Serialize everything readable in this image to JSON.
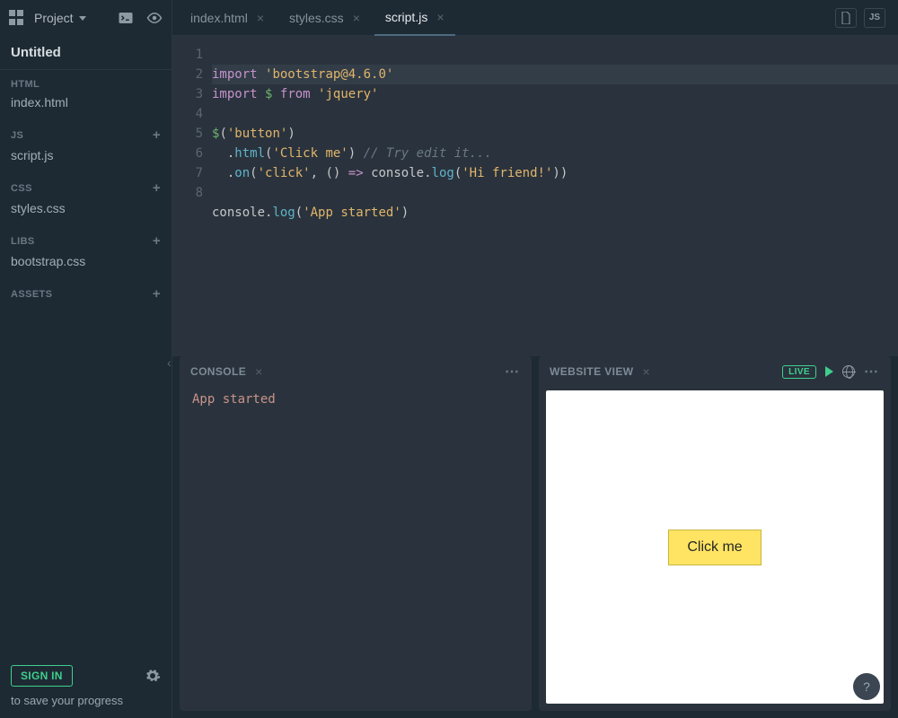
{
  "sidebar": {
    "project_label": "Project",
    "title": "Untitled",
    "sections": {
      "html": {
        "label": "HTML",
        "file": "index.html"
      },
      "js": {
        "label": "JS",
        "file": "script.js"
      },
      "css": {
        "label": "CSS",
        "file": "styles.css"
      },
      "libs": {
        "label": "LIBS",
        "file": "bootstrap.css"
      },
      "assets": {
        "label": "ASSETS"
      }
    },
    "sign_in_label": "SIGN IN",
    "save_note": "to save your progress"
  },
  "tabs": [
    {
      "label": "index.html",
      "active": false
    },
    {
      "label": "styles.css",
      "active": false
    },
    {
      "label": "script.js",
      "active": true
    }
  ],
  "right_chips": {
    "file": "file-icon",
    "js": "JS"
  },
  "code": {
    "lines": [
      "1",
      "2",
      "3",
      "4",
      "5",
      "6",
      "7",
      "8"
    ],
    "l1": {
      "kw": "import",
      "str": "'bootstrap@4.6.0'"
    },
    "l2": {
      "kw": "import",
      "var": "$",
      "from": "from",
      "str": "'jquery'"
    },
    "l4": {
      "var": "$",
      "open": "(",
      "str": "'button'",
      "close": ")"
    },
    "l5": {
      "dot": "  .",
      "fn": "html",
      "open": "(",
      "str": "'Click me'",
      "close": ") ",
      "cm": "// Try edit it..."
    },
    "l6": {
      "dot": "  .",
      "fn": "on",
      "open": "(",
      "str1": "'click'",
      "comma": ", () ",
      "arrow": "=>",
      "sp": " ",
      "obj": "console",
      "dot2": ".",
      "fn2": "log",
      "open2": "(",
      "str2": "'Hi friend!'",
      "close": "))"
    },
    "l8": {
      "obj": "console",
      "dot": ".",
      "fn": "log",
      "open": "(",
      "str": "'App started'",
      "close": ")"
    }
  },
  "console": {
    "title": "CONSOLE",
    "output": "App started"
  },
  "preview": {
    "title": "WEBSITE VIEW",
    "live": "LIVE",
    "button_label": "Click me"
  },
  "help": "?"
}
